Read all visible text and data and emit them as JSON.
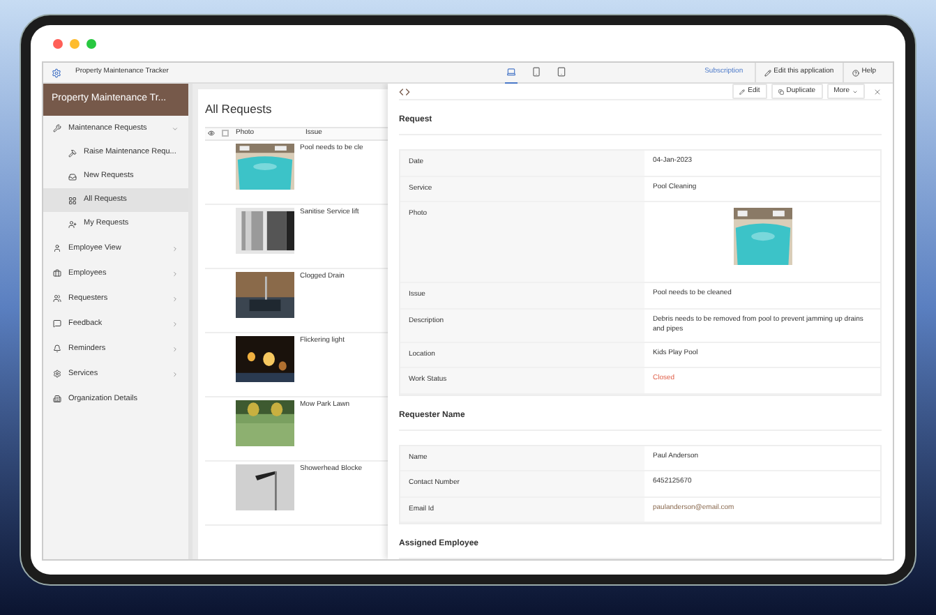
{
  "app_bar": {
    "app_name": "Property Maintenance Tracker",
    "device_tabs": [
      {
        "selected": true
      },
      {
        "selected": false
      },
      {
        "selected": false
      }
    ],
    "subscription": "Subscription",
    "edit_app": "Edit this application",
    "help": "Help"
  },
  "sidebar": {
    "title": "Property Maintenance Tr...",
    "items": [
      {
        "label": "Maintenance Requests",
        "kind": "group",
        "expanded": true,
        "selected": false,
        "children": [
          {
            "label": "Raise Maintenance Requ...",
            "selected": false
          },
          {
            "label": "New Requests",
            "selected": false
          },
          {
            "label": "All Requests",
            "selected": true
          },
          {
            "label": "My Requests",
            "selected": false
          }
        ]
      },
      {
        "label": "Employee View",
        "kind": "group",
        "expanded": false,
        "selected": false
      },
      {
        "label": "Employees",
        "kind": "group",
        "expanded": false,
        "selected": false
      },
      {
        "label": "Requesters",
        "kind": "group",
        "expanded": false,
        "selected": false
      },
      {
        "label": "Feedback",
        "kind": "group",
        "expanded": false,
        "selected": false
      },
      {
        "label": "Reminders",
        "kind": "group",
        "expanded": false,
        "selected": false
      },
      {
        "label": "Services",
        "kind": "group",
        "expanded": false,
        "selected": false
      },
      {
        "label": "Organization Details",
        "kind": "link",
        "selected": false
      }
    ]
  },
  "list": {
    "title": "All Requests",
    "select_all": {
      "checked": false
    },
    "columns": [
      "Photo",
      "Issue"
    ],
    "rows": [
      {
        "issue": "Pool needs to be cle"
      },
      {
        "issue": "Sanitise Service lift"
      },
      {
        "issue": "Clogged Drain"
      },
      {
        "issue": "Flickering light"
      },
      {
        "issue": "Mow Park Lawn"
      },
      {
        "issue": "Showerhead Blocke"
      }
    ]
  },
  "detail": {
    "actions": [
      "Edit",
      "Duplicate",
      "More"
    ],
    "sections": [
      {
        "title": "Request",
        "fields": [
          {
            "label": "Date",
            "kind": "text",
            "value": "04-Jan-2023"
          },
          {
            "label": "Service",
            "kind": "text",
            "value": "Pool Cleaning"
          },
          {
            "label": "Photo",
            "kind": "picture"
          },
          {
            "label": "Issue",
            "kind": "text",
            "value": "Pool needs to be cleaned"
          },
          {
            "label": "Description",
            "kind": "text",
            "value": "Debris needs to be removed from pool to prevent jamming up drains and pipes"
          },
          {
            "label": "Location",
            "kind": "text",
            "value": "Kids Play Pool"
          },
          {
            "label": "Work Status",
            "kind": "status",
            "value": "Closed"
          }
        ]
      },
      {
        "title": "Requester Name",
        "fields": [
          {
            "label": "Name",
            "kind": "text",
            "value": "Paul Anderson"
          },
          {
            "label": "Contact Number",
            "kind": "text",
            "value": "6452125670"
          },
          {
            "label": "Email Id",
            "kind": "link",
            "value": "paulanderson@email.com"
          }
        ]
      },
      {
        "title": "Assigned Employee"
      }
    ]
  }
}
